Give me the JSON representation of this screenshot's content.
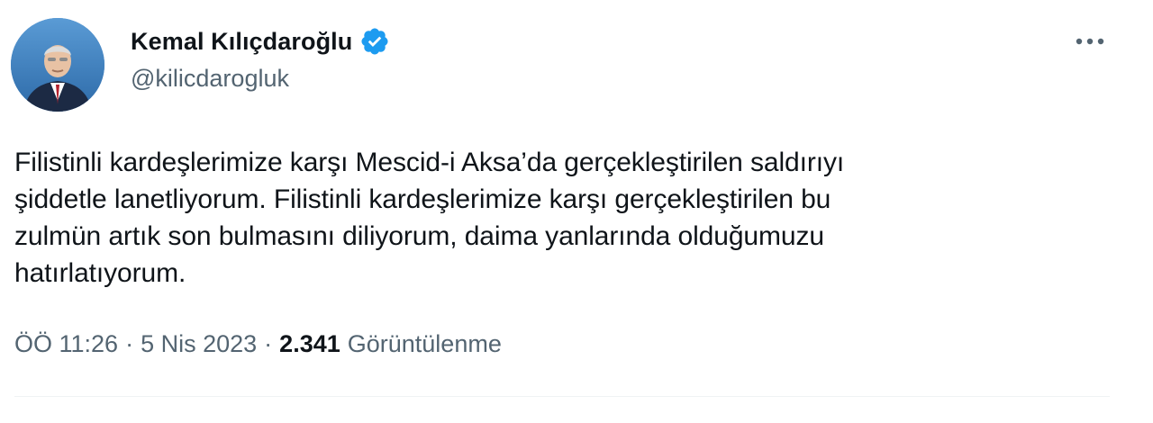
{
  "author": {
    "display_name": "Kemal Kılıçdaroğlu",
    "handle": "@kilicdarogluk",
    "verified": true,
    "verified_color": "#1d9bf0",
    "avatar_icon": "profile-photo"
  },
  "tweet": {
    "text": "Filistinli kardeşlerimize karşı Mescid-i Aksa’da gerçekleştirilen saldırıyı\nşiddetle lanetliyorum. Filistinli kardeşlerimize karşı gerçekleştirilen bu\nzulmün artık son bulmasını diliyorum, daima yanlarında olduğumuzu\nhatırlatıyorum."
  },
  "meta": {
    "time": "ÖÖ 11:26",
    "separator_1": "·",
    "date": "5 Nis 2023",
    "separator_2": "·",
    "views_count": "2.341",
    "views_label": "Görüntülenme"
  },
  "actions": {
    "more_icon": "more-dots-icon"
  },
  "colors": {
    "text_primary": "#0f1419",
    "text_secondary": "#536471",
    "divider": "#eff3f4",
    "background": "#ffffff"
  }
}
